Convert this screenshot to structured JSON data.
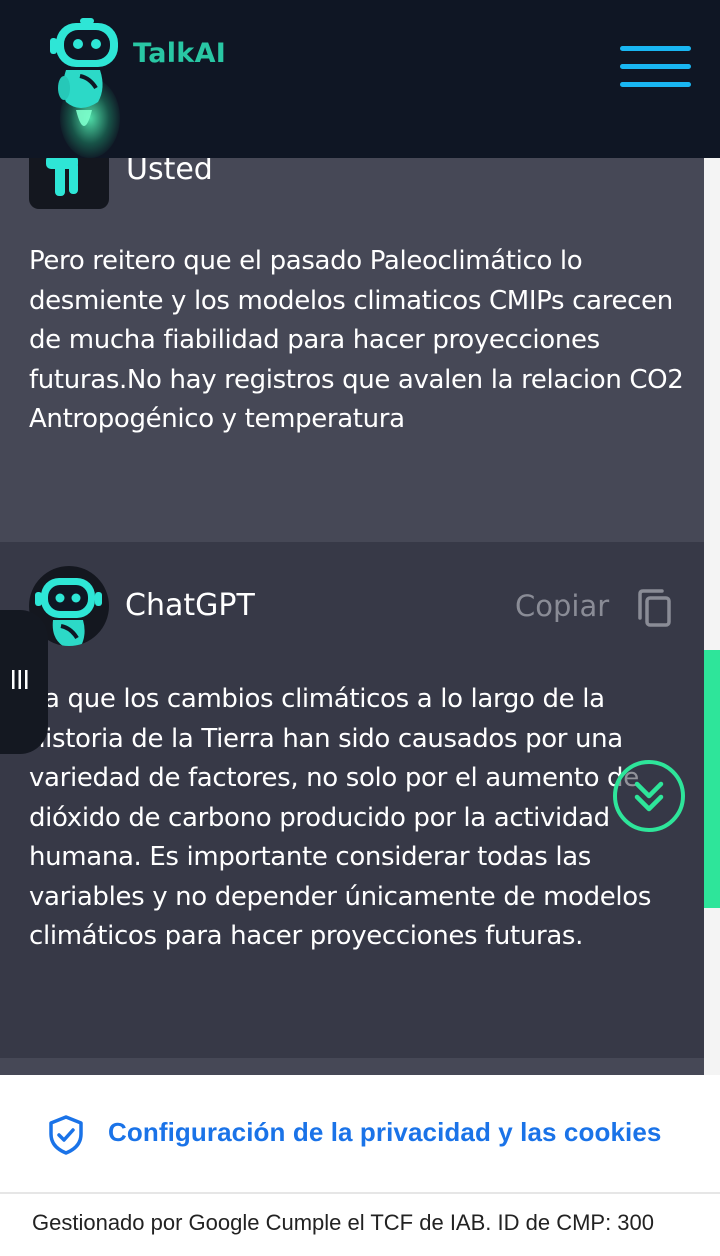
{
  "app": {
    "brand": "TalkAI"
  },
  "messages": [
    {
      "author": "Usted",
      "text": "Pero reitero que el pasado Paleoclimático lo desmiente y los modelos climaticos CMIPs carecen de mucha fiabilidad para hacer proyecciones futuras.No hay registros que avalen la relacion CO2 Antropogénico y temperatura"
    },
    {
      "author": "ChatGPT",
      "copy_label": "Copiar",
      "text": "ya que los cambios climáticos a lo largo de la historia de la Tierra han sido causados por una variedad de factores, no solo por el aumento de dióxido de carbono producido por la actividad humana. Es importante considerar todas las variables y no depender únicamente de modelos climáticos para hacer proyecciones futuras."
    }
  ],
  "consent": {
    "link_label": "Configuración de la privacidad y las cookies",
    "footer": "Gestionado por Google Cumple el TCF de IAB. ID de CMP: 300"
  },
  "icons": {
    "menu": "hamburger-menu-icon",
    "copy": "copy-icon",
    "scroll_down": "double-chevron-down-icon",
    "side_handle": "vertical-bars-icon",
    "consent": "shield-check-icon"
  },
  "colors": {
    "header_bg": "#0f1624",
    "brand": "#29c7a4",
    "menu": "#19b6f2",
    "user_msg_bg": "#464856",
    "bot_msg_bg": "#373947",
    "accent_green": "#2ee59a",
    "consent_link": "#1a73e8"
  }
}
